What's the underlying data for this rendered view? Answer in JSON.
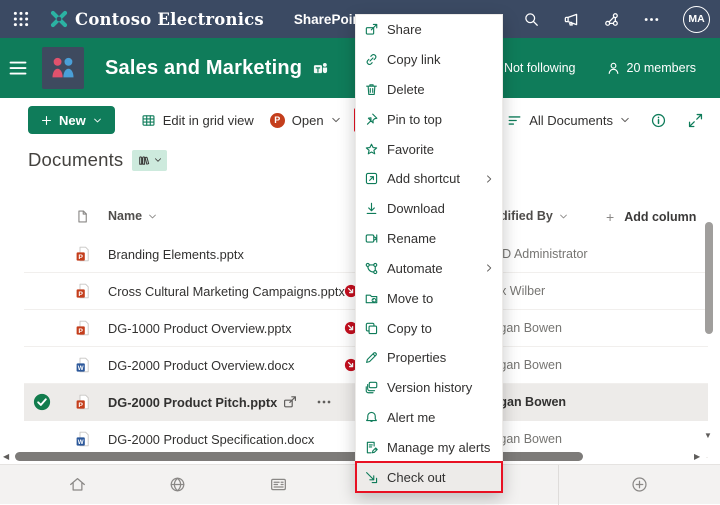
{
  "colors": {
    "theme_green": "#0f7c5a",
    "suite_bar_navy": "#3b4a63",
    "highlight_red": "#e81123",
    "checked_out_red": "#c50f1f",
    "powerpoint_orange": "#c43e1c",
    "word_blue": "#2b579a",
    "selected_row_gray": "#edebe9"
  },
  "topbar": {
    "brand": "Contoso Electronics",
    "product": "SharePoint",
    "avatar_initials": "MA"
  },
  "site": {
    "title": "Sales and Marketing",
    "follow_label": "Not following",
    "members_label": "20 members"
  },
  "command_bar": {
    "new_label": "New",
    "edit_grid_label": "Edit in grid view",
    "open_label": "Open",
    "powerpoint_letter": "P",
    "view_selector_label": "All Documents"
  },
  "library": {
    "heading": "Documents"
  },
  "table": {
    "name_header": "Name",
    "modified_by_header": "Modified By",
    "add_column_label": "Add column",
    "add_column_plus": "+",
    "rows": [
      {
        "name": "Branding Elements.pptx",
        "file_type": "pptx",
        "checked_out": false,
        "selected": false,
        "modified_by": "MOD Administrator"
      },
      {
        "name": "Cross Cultural Marketing Campaigns.pptx",
        "file_type": "pptx",
        "checked_out": true,
        "selected": false,
        "modified_by": "Alex Wilber"
      },
      {
        "name": "DG-1000 Product Overview.pptx",
        "file_type": "pptx",
        "checked_out": true,
        "selected": false,
        "modified_by": "Megan Bowen"
      },
      {
        "name": "DG-2000 Product Overview.docx",
        "file_type": "docx",
        "checked_out": true,
        "selected": false,
        "modified_by": "Megan Bowen"
      },
      {
        "name": "DG-2000 Product Pitch.pptx",
        "file_type": "pptx",
        "checked_out": false,
        "selected": true,
        "modified_by": "Megan Bowen"
      },
      {
        "name": "DG-2000 Product Specification.docx",
        "file_type": "docx",
        "checked_out": false,
        "selected": false,
        "modified_by": "Megan Bowen"
      }
    ]
  },
  "context_menu": {
    "items": [
      {
        "label": "Share",
        "icon": "m-share",
        "icon_name": "share-icon",
        "submenu": false,
        "highlighted": false
      },
      {
        "label": "Copy link",
        "icon": "m-link",
        "icon_name": "copy-link-icon",
        "submenu": false,
        "highlighted": false
      },
      {
        "label": "Delete",
        "icon": "m-trash",
        "icon_name": "delete-icon",
        "submenu": false,
        "highlighted": false
      },
      {
        "label": "Pin to top",
        "icon": "m-pin",
        "icon_name": "pin-icon",
        "submenu": false,
        "highlighted": false
      },
      {
        "label": "Favorite",
        "icon": "m-star",
        "icon_name": "favorite-icon",
        "submenu": false,
        "highlighted": false
      },
      {
        "label": "Add shortcut",
        "icon": "m-shortcut",
        "icon_name": "add-shortcut-icon",
        "submenu": true,
        "highlighted": false
      },
      {
        "label": "Download",
        "icon": "m-download",
        "icon_name": "download-icon",
        "submenu": false,
        "highlighted": false
      },
      {
        "label": "Rename",
        "icon": "m-rename",
        "icon_name": "rename-icon",
        "submenu": false,
        "highlighted": false
      },
      {
        "label": "Automate",
        "icon": "m-automate",
        "icon_name": "automate-icon",
        "submenu": true,
        "highlighted": false
      },
      {
        "label": "Move to",
        "icon": "m-move",
        "icon_name": "move-to-icon",
        "submenu": false,
        "highlighted": false
      },
      {
        "label": "Copy to",
        "icon": "m-copy",
        "icon_name": "copy-to-icon",
        "submenu": false,
        "highlighted": false
      },
      {
        "label": "Properties",
        "icon": "m-pencil",
        "icon_name": "properties-icon",
        "submenu": false,
        "highlighted": false
      },
      {
        "label": "Version history",
        "icon": "m-history",
        "icon_name": "version-history-icon",
        "submenu": false,
        "highlighted": false
      },
      {
        "label": "Alert me",
        "icon": "m-bell",
        "icon_name": "alert-me-icon",
        "submenu": false,
        "highlighted": false
      },
      {
        "label": "Manage my alerts",
        "icon": "m-managealerts",
        "icon_name": "manage-alerts-icon",
        "submenu": false,
        "highlighted": false
      },
      {
        "label": "Check out",
        "icon": "m-checkout",
        "icon_name": "check-out-icon",
        "submenu": false,
        "highlighted": true
      }
    ]
  }
}
